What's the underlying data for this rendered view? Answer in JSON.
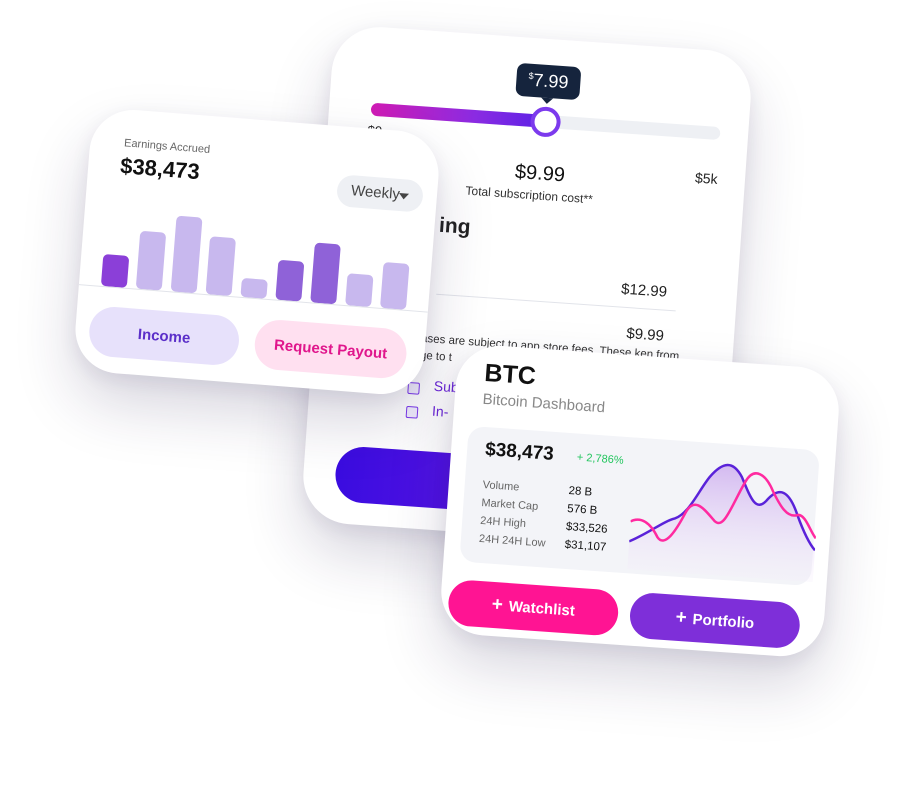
{
  "subscription": {
    "slider_tip_currency": "$",
    "slider_tip_value": "7.99",
    "slider_value_fraction": 0.5,
    "min_label": "$0",
    "max_label": "$5k",
    "price": "$9.99",
    "caption": "Total subscription cost**",
    "heading_fragment": "ing",
    "row1_value": "$12.99",
    "row2_value": "$9.99",
    "note_fragment": "ases are subject to app store fees. These ken from ge to t",
    "check1_fragment": "Sub",
    "check2_fragment": "In-"
  },
  "earnings": {
    "label": "Earnings Accrued",
    "value": "$38,473",
    "period": "Weekly",
    "bar_levels": [
      0.36,
      0.66,
      0.86,
      0.66,
      0.22,
      0.46,
      0.68,
      0.36,
      0.52
    ],
    "bar_colors": [
      "#8b3fd8",
      "#c8b8ee",
      "#c8b8ee",
      "#c8b8ee",
      "#c8b8ee",
      "#8f62d8",
      "#8f62d8",
      "#c8b8ee",
      "#c8b8ee"
    ],
    "income_label": "Income",
    "payout_label": "Request Payout"
  },
  "btc": {
    "title": "BTC",
    "subtitle": "Bitcoin Dashboard",
    "price": "$38,473",
    "change": "+ 2,786%",
    "stats": [
      {
        "label": "Volume",
        "value": "28 B"
      },
      {
        "label": "Market Cap",
        "value": "576 B"
      },
      {
        "label": "24H High",
        "value": "$33,526"
      },
      {
        "label": "24H 24H Low",
        "value": "$31,107"
      }
    ],
    "watchlist_label": "Watchlist",
    "portfolio_label": "Portfolio",
    "plus_icon": "+",
    "chart_colors": {
      "series_a": "#5a22d9",
      "series_b": "#ff2aa0"
    }
  }
}
